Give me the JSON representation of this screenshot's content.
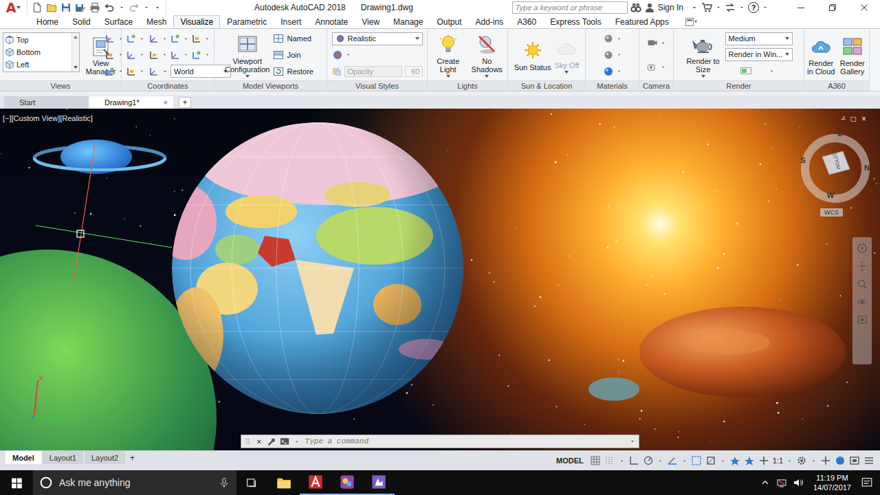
{
  "app": {
    "logo": "A",
    "title": "Autodesk AutoCAD 2018",
    "file": "Drawing1.dwg"
  },
  "search": {
    "placeholder": "Type a keyword or phrase"
  },
  "account": {
    "label": "Sign In"
  },
  "help": {
    "label": "?"
  },
  "ribbon_tabs": [
    {
      "label": "Home",
      "selected": false
    },
    {
      "label": "Solid",
      "selected": false
    },
    {
      "label": "Surface",
      "selected": false
    },
    {
      "label": "Mesh",
      "selected": false
    },
    {
      "label": "Visualize",
      "selected": true
    },
    {
      "label": "Parametric",
      "selected": false
    },
    {
      "label": "Insert",
      "selected": false
    },
    {
      "label": "Annotate",
      "selected": false
    },
    {
      "label": "View",
      "selected": false
    },
    {
      "label": "Manage",
      "selected": false
    },
    {
      "label": "Output",
      "selected": false
    },
    {
      "label": "Add-ins",
      "selected": false
    },
    {
      "label": "A360",
      "selected": false
    },
    {
      "label": "Express Tools",
      "selected": false
    },
    {
      "label": "Featured Apps",
      "selected": false
    }
  ],
  "panels": [
    {
      "title": "Views",
      "columns": [
        [
          {
            "kind": "listrow",
            "label": "Top"
          },
          {
            "kind": "listrow",
            "label": "Bottom"
          },
          {
            "kind": "listrow",
            "label": "Left"
          }
        ],
        [
          {
            "kind": "big",
            "label": "View Manager",
            "disabled": false,
            "has_menu": false
          }
        ]
      ]
    },
    {
      "title": "Coordinates",
      "columns": [
        [
          {
            "kind": "icons"
          },
          {
            "kind": "icons"
          },
          {
            "kind": "icons"
          }
        ],
        [
          {
            "kind": "icons"
          },
          {
            "kind": "icons"
          },
          {
            "kind": "select",
            "label": "World"
          }
        ]
      ]
    },
    {
      "title": "Model Viewports",
      "columns": [
        [
          {
            "kind": "big",
            "label": "Viewport Configuration",
            "disabled": false,
            "has_menu": true
          }
        ],
        [
          {
            "kind": "row",
            "label": "Named"
          },
          {
            "kind": "row",
            "label": "Join"
          },
          {
            "kind": "row",
            "label": "Restore"
          }
        ]
      ]
    },
    {
      "title": "Visual Styles",
      "columns": [
        [
          {
            "kind": "select",
            "label": "Realistic"
          },
          {
            "kind": "icons"
          },
          {
            "kind": "opacity",
            "label": "Opacity",
            "value": "60",
            "disabled": true
          }
        ]
      ]
    },
    {
      "title": "Lights",
      "columns": [
        [
          {
            "kind": "big",
            "label": "Create Light",
            "disabled": false,
            "has_menu": true
          }
        ],
        [
          {
            "kind": "big",
            "label": "No Shadows",
            "disabled": false,
            "has_menu": true
          }
        ]
      ]
    },
    {
      "title": "Sun & Location",
      "columns": [
        [
          {
            "kind": "big",
            "label": "Sun Status",
            "disabled": false,
            "has_menu": false
          }
        ],
        [
          {
            "kind": "big",
            "label": "Sky Off",
            "disabled": true,
            "has_menu": true
          }
        ]
      ]
    },
    {
      "title": "Materials",
      "columns": [
        [
          {
            "kind": "icons"
          },
          {
            "kind": "icons"
          },
          {
            "kind": "icons"
          }
        ]
      ]
    },
    {
      "title": "Camera",
      "columns": [
        [
          {
            "kind": "icons"
          },
          {
            "kind": "icons"
          }
        ]
      ]
    },
    {
      "title": "Render",
      "columns": [
        [
          {
            "kind": "big",
            "label": "Render to Size",
            "disabled": false,
            "has_menu": true
          }
        ],
        [
          {
            "kind": "select",
            "label": "Medium"
          },
          {
            "kind": "select",
            "label": "Render in Win..."
          },
          {
            "kind": "icons"
          }
        ]
      ]
    },
    {
      "title": "A360",
      "columns": [
        [
          {
            "kind": "big",
            "label": "Render in Cloud",
            "disabled": false,
            "has_menu": false
          }
        ],
        [
          {
            "kind": "big",
            "label": "Render Gallery",
            "disabled": false,
            "has_menu": false
          }
        ]
      ]
    }
  ],
  "doc_tabs": [
    {
      "label": "Start",
      "selected": false
    },
    {
      "label": "Drawing1*",
      "selected": true,
      "close": "×"
    }
  ],
  "new_tab": "+",
  "viewport": {
    "label": "[−][Custom View][Realistic]",
    "controls": [
      "−",
      "□",
      "×"
    ]
  },
  "viewcube": {
    "directions": [
      "S",
      "E",
      "N",
      "W"
    ],
    "face": "BOTTOM",
    "ucs": "WCS"
  },
  "ucs_axes": [
    "X",
    "Y"
  ],
  "command": {
    "close": "×",
    "placeholder": "Type a command"
  },
  "layout_tabs": [
    {
      "label": "Model",
      "selected": true
    },
    {
      "label": "Layout1",
      "selected": false
    },
    {
      "label": "Layout2",
      "selected": false
    }
  ],
  "layout_new": "+",
  "status": {
    "mode": "MODEL",
    "scale": "1:1"
  },
  "taskbar": {
    "search": "Ask me anything",
    "time": "11:19 PM",
    "date": "14/07/2017"
  }
}
